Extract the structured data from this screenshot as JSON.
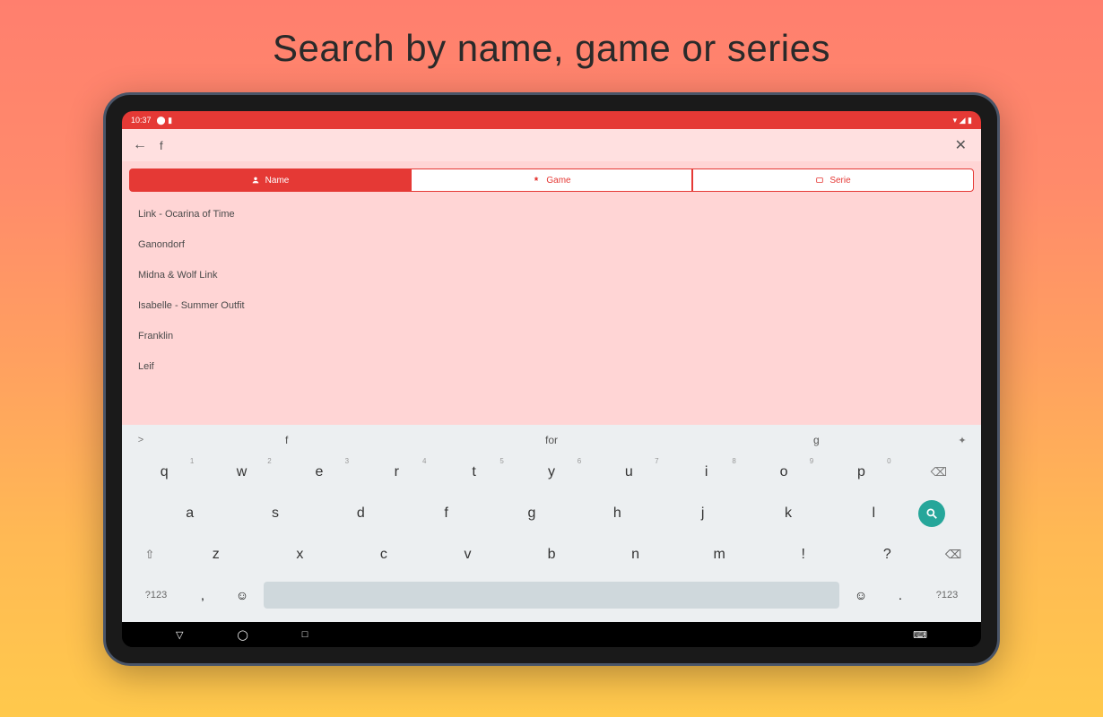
{
  "promo": {
    "title": "Search by name, game or series"
  },
  "status": {
    "time": "10:37",
    "icons_left": "⬤ ▮",
    "icons_right": "▾ ◢ ▮"
  },
  "search": {
    "back_icon": "←",
    "query": "f",
    "clear_icon": "✕"
  },
  "tabs": [
    {
      "label": "Name",
      "active": true
    },
    {
      "label": "Game",
      "active": false
    },
    {
      "label": "Serie",
      "active": false
    }
  ],
  "results": [
    "Link - Ocarina of Time",
    "Ganondorf",
    "Midna & Wolf Link",
    "Isabelle - Summer Outfit",
    "Franklin",
    "Leif"
  ],
  "suggestions": {
    "left": ">",
    "items": [
      "f",
      "for",
      "g"
    ],
    "right": "✦"
  },
  "keyboard": {
    "row1": [
      {
        "k": "q",
        "h": "1"
      },
      {
        "k": "w",
        "h": "2"
      },
      {
        "k": "e",
        "h": "3"
      },
      {
        "k": "r",
        "h": "4"
      },
      {
        "k": "t",
        "h": "5"
      },
      {
        "k": "y",
        "h": "6"
      },
      {
        "k": "u",
        "h": "7"
      },
      {
        "k": "i",
        "h": "8"
      },
      {
        "k": "o",
        "h": "9"
      },
      {
        "k": "p",
        "h": "0"
      }
    ],
    "row2": [
      "a",
      "s",
      "d",
      "f",
      "g",
      "h",
      "j",
      "k",
      "l"
    ],
    "row3_shift": "⇧",
    "row3": [
      "z",
      "x",
      "c",
      "v",
      "b",
      "n",
      "m"
    ],
    "row3_punct": [
      "!",
      "?"
    ],
    "row3_del": "⌫",
    "bottom": {
      "numswitch_l": "?123",
      "comma": ",",
      "emoji": "☺",
      "period": ".",
      "numswitch_r": "?123"
    },
    "backspace_extra": "⌫"
  },
  "nav": {
    "back": "▽",
    "home": "◯",
    "recent": "□",
    "kb": "⌨"
  }
}
